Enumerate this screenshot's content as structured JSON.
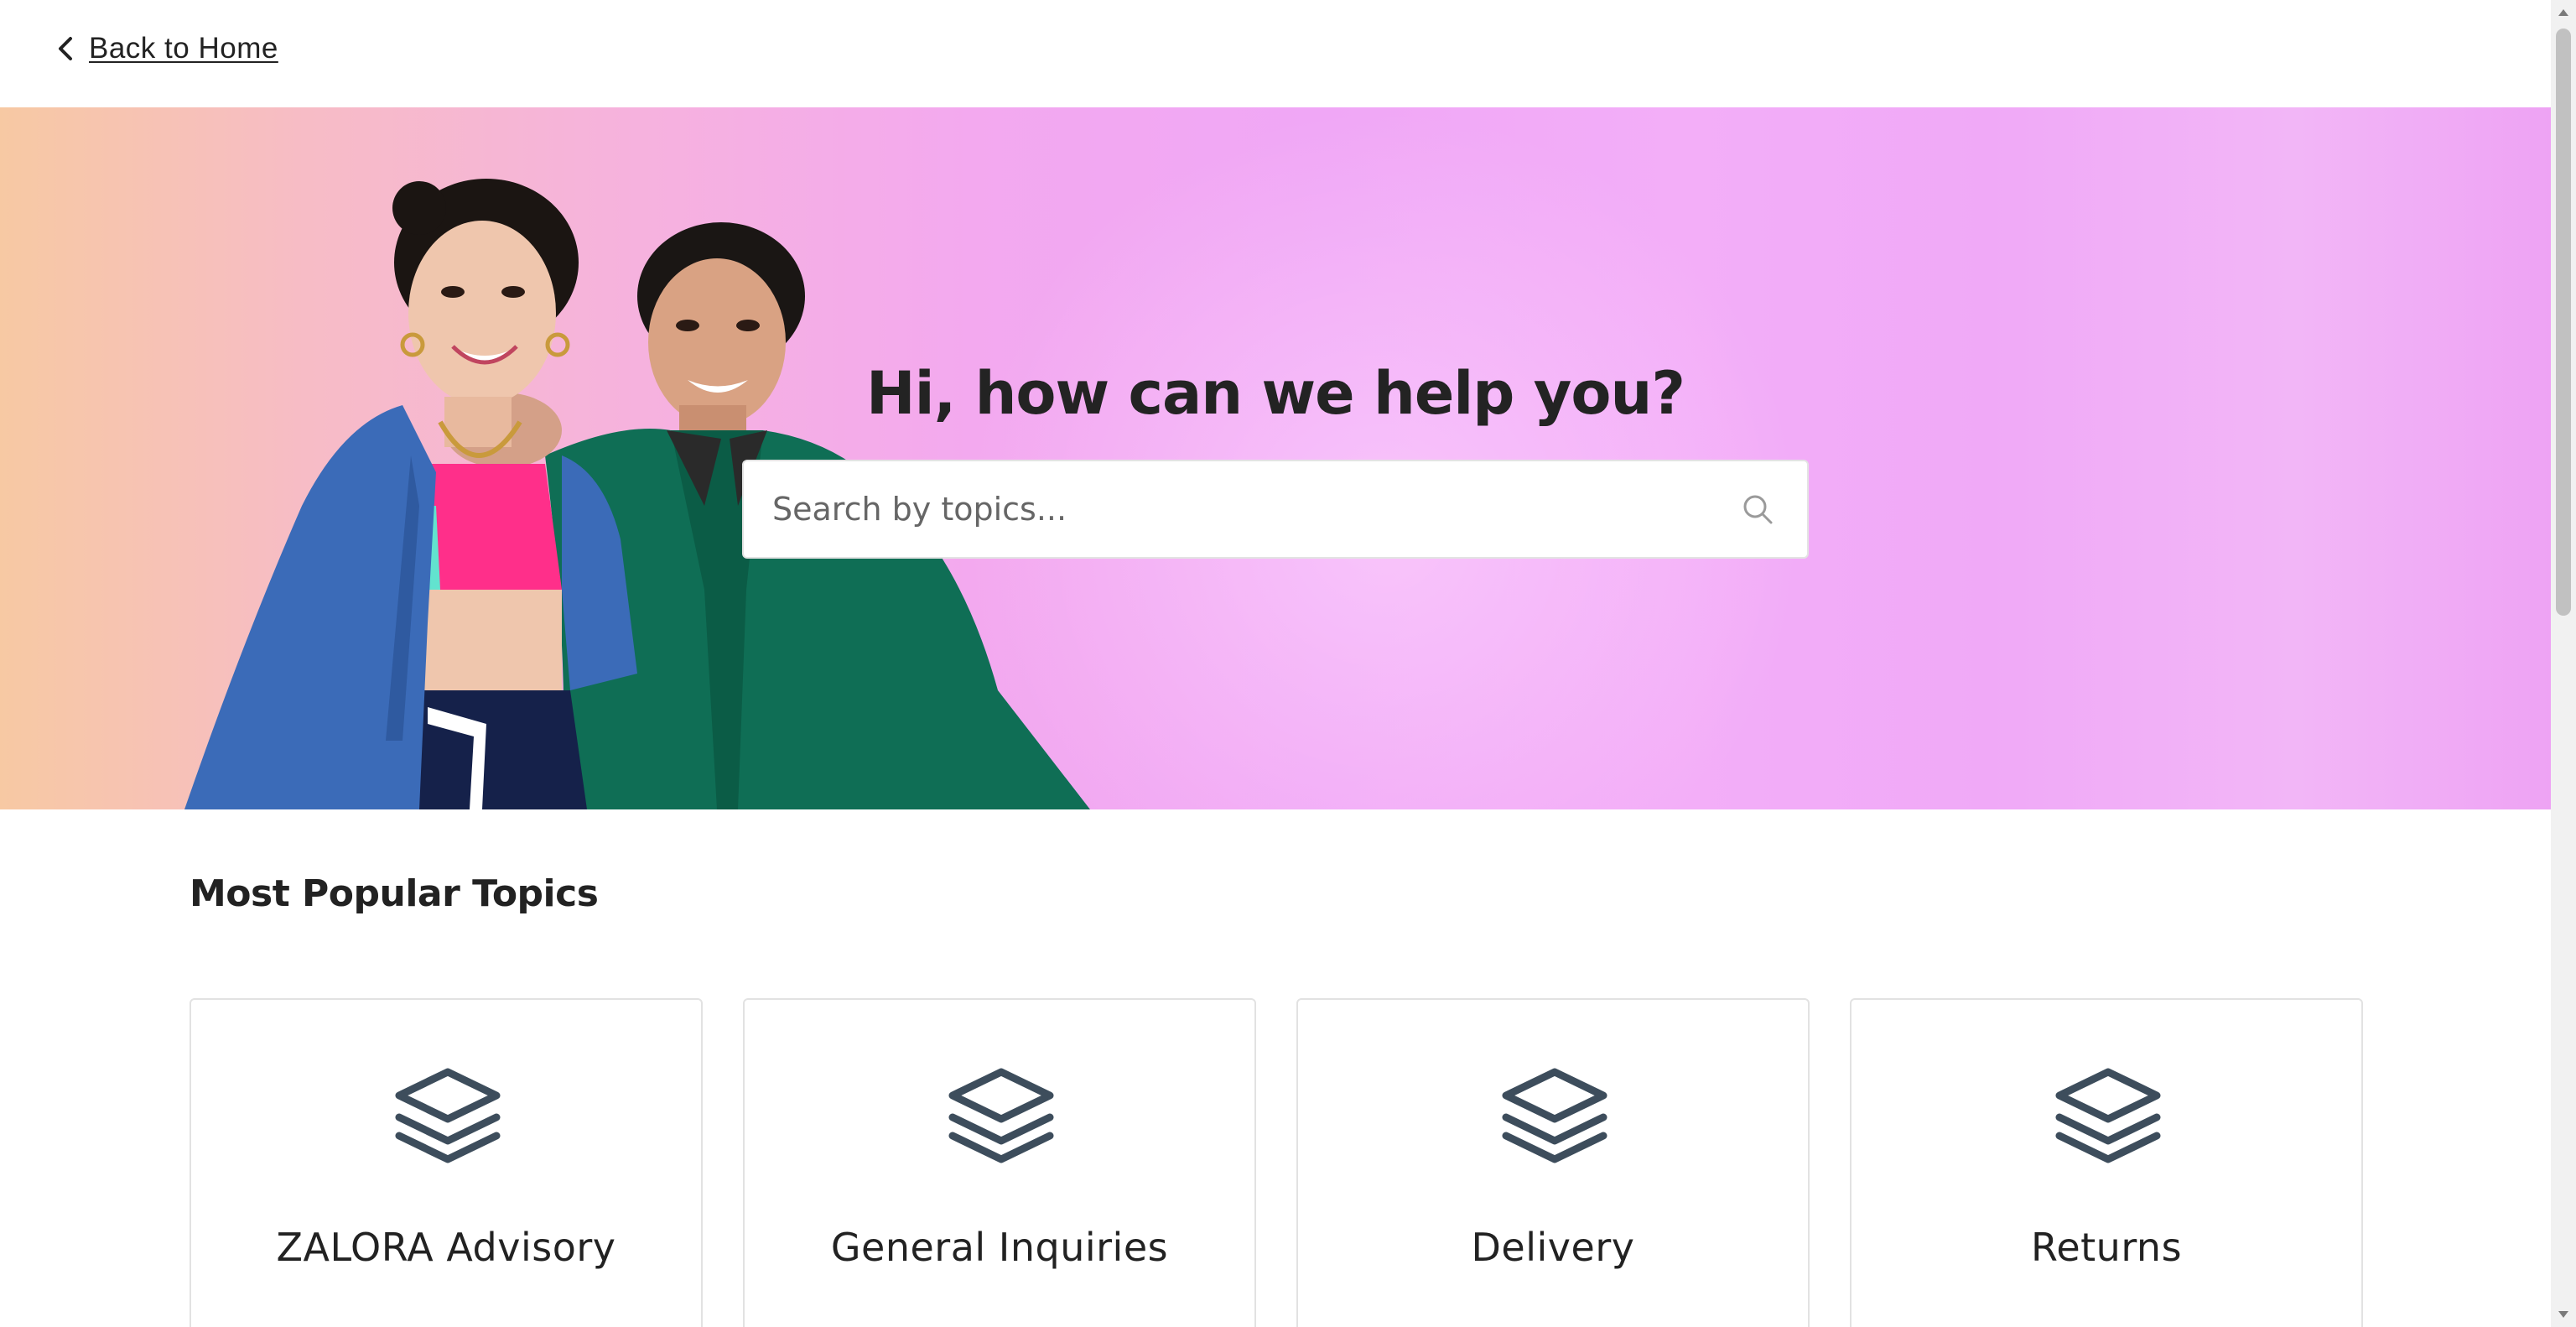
{
  "nav": {
    "back_label": "Back to Home",
    "back_icon": "chevron-left-icon"
  },
  "hero": {
    "title": "Hi, how can we help you?",
    "search": {
      "placeholder": "Search by topics...",
      "value": "",
      "icon": "search-icon"
    }
  },
  "topics": {
    "heading": "Most Popular Topics",
    "items": [
      {
        "label": "ZALORA Advisory",
        "icon": "layers-icon"
      },
      {
        "label": "General Inquiries",
        "icon": "layers-icon"
      },
      {
        "label": "Delivery",
        "icon": "layers-icon"
      },
      {
        "label": "Returns",
        "icon": "layers-icon"
      }
    ]
  },
  "colors": {
    "text": "#222222",
    "icon": "#3d4d5c",
    "hero_left": "#f7c9a3",
    "hero_right": "#f0a7f6",
    "card_border": "#e2e2e2"
  }
}
